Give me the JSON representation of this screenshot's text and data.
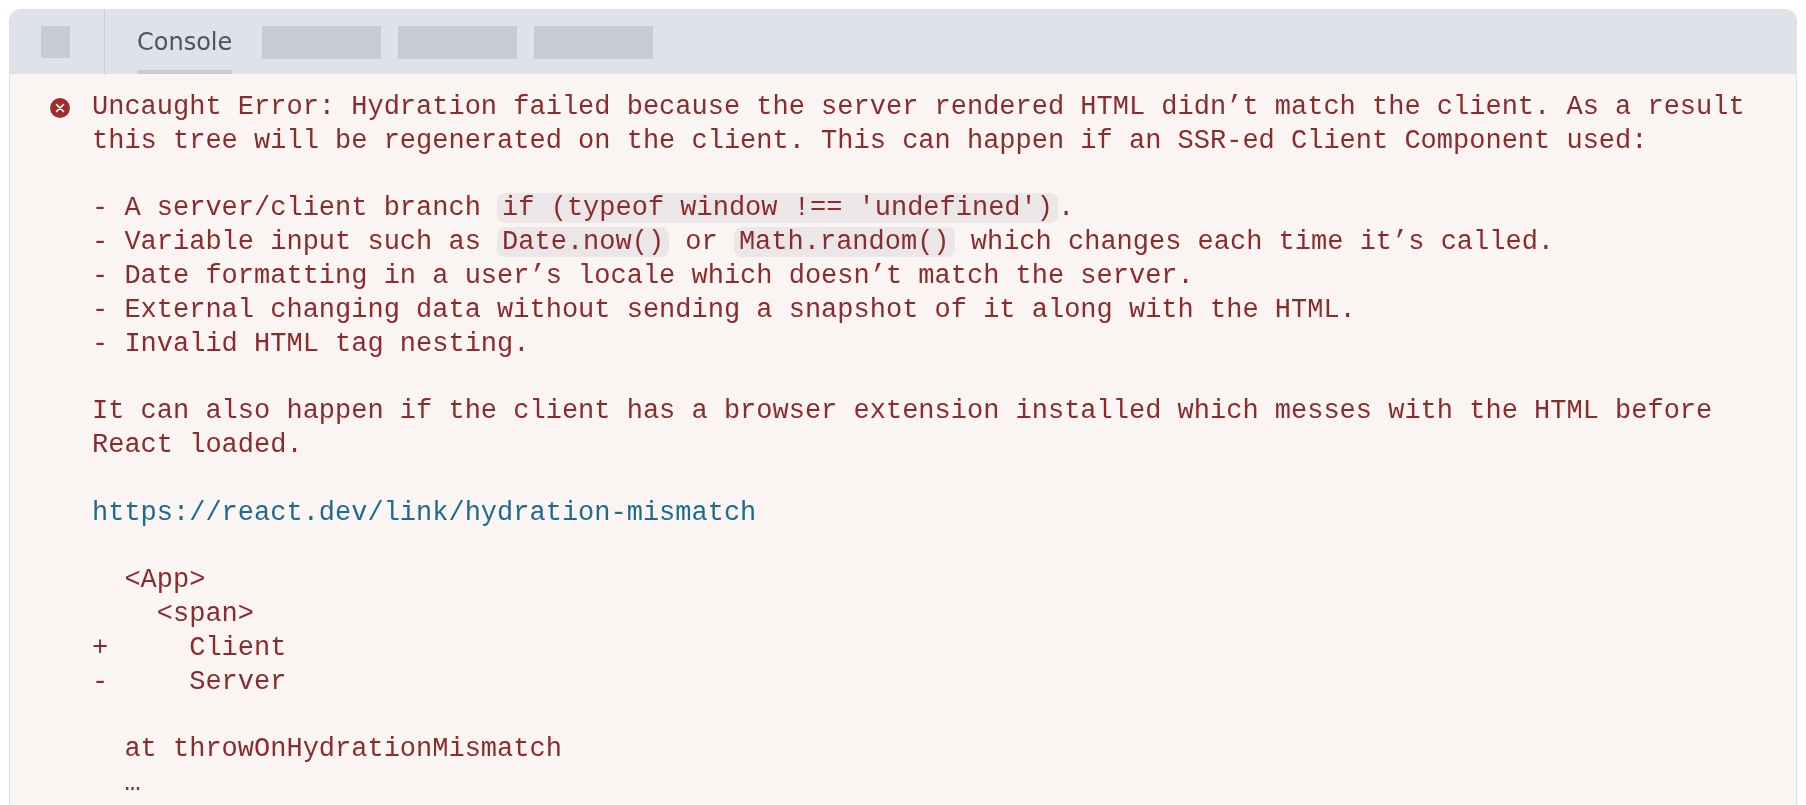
{
  "tabs": [
    {
      "kind": "label",
      "label": "Console",
      "selected": true
    },
    {
      "kind": "redacted",
      "selected": false
    },
    {
      "kind": "redacted",
      "selected": false
    },
    {
      "kind": "redacted",
      "selected": false
    }
  ],
  "console": {
    "paragraphs": [
      {
        "lines": [
          {
            "segments": [
              {
                "kind": "text",
                "text": "Uncaught Error: Hydration failed because the server rendered HTML didn’t match the client. As a result"
              }
            ]
          },
          {
            "segments": [
              {
                "kind": "text",
                "text": "this tree will be regenerated on the client. This can happen if an SSR-ed Client Component used:"
              }
            ]
          }
        ]
      },
      {
        "lines": [
          {
            "segments": [
              {
                "kind": "text",
                "text": "- A server/client branch "
              },
              {
                "kind": "code",
                "text": "if (typeof window !== 'undefined')"
              },
              {
                "kind": "text",
                "text": "."
              }
            ]
          },
          {
            "segments": [
              {
                "kind": "text",
                "text": "- Variable input such as "
              },
              {
                "kind": "code",
                "text": "Date.now()"
              },
              {
                "kind": "text",
                "text": " or "
              },
              {
                "kind": "code",
                "text": "Math.random()"
              },
              {
                "kind": "text",
                "text": " which changes each time it’s called."
              }
            ]
          },
          {
            "segments": [
              {
                "kind": "text",
                "text": "- Date formatting in a user’s locale which doesn’t match the server."
              }
            ]
          },
          {
            "segments": [
              {
                "kind": "text",
                "text": "- External changing data without sending a snapshot of it along with the HTML."
              }
            ]
          },
          {
            "segments": [
              {
                "kind": "text",
                "text": "- Invalid HTML tag nesting."
              }
            ]
          }
        ]
      },
      {
        "lines": [
          {
            "segments": [
              {
                "kind": "text",
                "text": "It can also happen if the client has a browser extension installed which messes with the HTML before"
              }
            ]
          },
          {
            "segments": [
              {
                "kind": "text",
                "text": "React loaded."
              }
            ]
          }
        ]
      },
      {
        "lines": [
          {
            "segments": [
              {
                "kind": "link",
                "text": "https://react.dev/link/hydration-mismatch"
              }
            ]
          }
        ]
      },
      {
        "lines": [
          {
            "segments": [
              {
                "kind": "text",
                "text": "  <App>"
              }
            ]
          },
          {
            "segments": [
              {
                "kind": "text",
                "text": "    <span>"
              }
            ]
          },
          {
            "segments": [
              {
                "kind": "text",
                "text": "+     Client"
              }
            ]
          },
          {
            "segments": [
              {
                "kind": "text",
                "text": "-     Server"
              }
            ]
          }
        ]
      },
      {
        "lines": [
          {
            "segments": [
              {
                "kind": "text",
                "text": "  at throwOnHydrationMismatch"
              }
            ]
          },
          {
            "segments": [
              {
                "kind": "text",
                "text": "  …"
              }
            ]
          }
        ]
      }
    ]
  }
}
